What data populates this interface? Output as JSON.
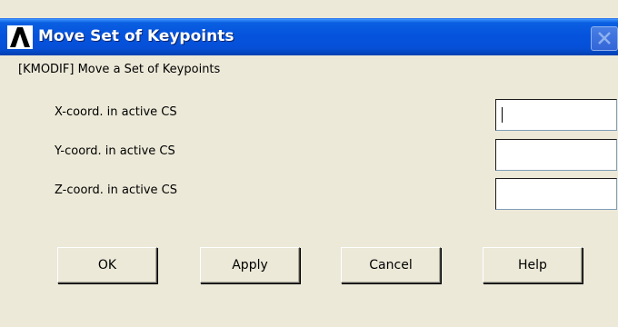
{
  "window": {
    "title": "Move Set of Keypoints",
    "app_icon": "ansys-lambda-icon",
    "close_icon": "close-icon"
  },
  "command_label": "[KMODIF]  Move a Set of Keypoints",
  "fields": [
    {
      "label": "X-coord. in active CS",
      "value": ""
    },
    {
      "label": "Y-coord. in active CS",
      "value": ""
    },
    {
      "label": "Z-coord. in active CS",
      "value": ""
    }
  ],
  "buttons": {
    "ok": "OK",
    "apply": "Apply",
    "cancel": "Cancel",
    "help": "Help"
  },
  "colors": {
    "titlebar": "#0553dd",
    "dialog_bg": "#ece9d8"
  }
}
